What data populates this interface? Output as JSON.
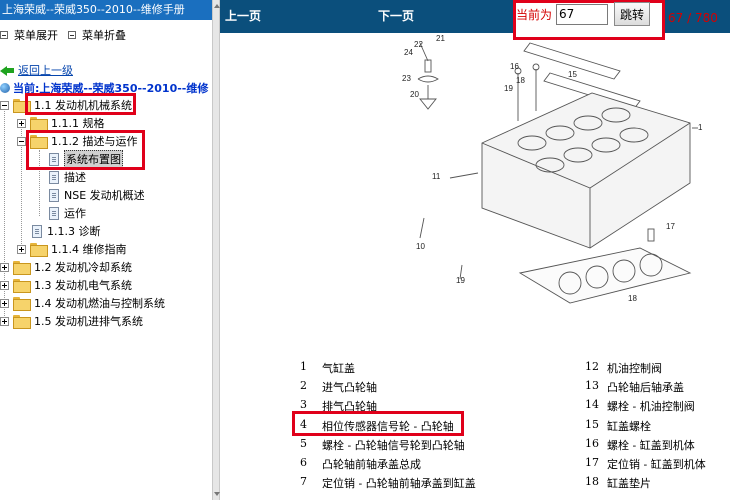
{
  "sidebar": {
    "title": "上海荣威--荣威350--2010--维修手册",
    "expand_label": "菜单展开",
    "collapse_label": "菜单折叠",
    "back_label": "返回上一级",
    "current_label": "当前:上海荣威--荣威350--2010--维修",
    "tree": [
      {
        "label": "1.1 发动机机械系统"
      },
      {
        "label": "1.1.1 规格"
      },
      {
        "label": "1.1.2 描述与运作"
      },
      {
        "label": "系统布置图"
      },
      {
        "label": "描述"
      },
      {
        "label": "NSE 发动机概述"
      },
      {
        "label": "运作"
      },
      {
        "label": "1.1.3 诊断"
      },
      {
        "label": "1.1.4 维修指南"
      },
      {
        "label": "1.2 发动机冷却系统"
      },
      {
        "label": "1.3 发动机电气系统"
      },
      {
        "label": "1.4 发动机燃油与控制系统"
      },
      {
        "label": "1.5 发动机进排气系统"
      }
    ]
  },
  "toolbar": {
    "prev_label": "上一页",
    "next_label": "下一页",
    "current_page_label": "当前为",
    "page_value": "67",
    "jump_label": "跳转",
    "page_count": "67 / 780"
  },
  "diagram": {
    "callouts": [
      "21",
      "24",
      "22",
      "23",
      "20",
      "16",
      "18",
      "15",
      "19",
      "1",
      "11",
      "10",
      "19",
      "17",
      "18"
    ]
  },
  "legend": [
    {
      "num": "1",
      "text": "气缸盖"
    },
    {
      "num": "12",
      "text": "机油控制阀"
    },
    {
      "num": "2",
      "text": "进气凸轮轴"
    },
    {
      "num": "13",
      "text": "凸轮轴后轴承盖"
    },
    {
      "num": "3",
      "text": "排气凸轮轴"
    },
    {
      "num": "14",
      "text": "螺栓 - 机油控制阀"
    },
    {
      "num": "4",
      "text": "相位传感器信号轮 - 凸轮轴"
    },
    {
      "num": "15",
      "text": "缸盖螺栓"
    },
    {
      "num": "5",
      "text": "螺栓 - 凸轮轴信号轮到凸轮轴"
    },
    {
      "num": "16",
      "text": "螺栓 - 缸盖到机体"
    },
    {
      "num": "6",
      "text": "凸轮轴前轴承盖总成"
    },
    {
      "num": "17",
      "text": "定位销 - 缸盖到机体"
    },
    {
      "num": "7",
      "text": "定位销 - 凸轮轴前轴承盖到缸盖"
    },
    {
      "num": "18",
      "text": "缸盖垫片"
    }
  ],
  "colors": {
    "accent_red": "#e0001a",
    "topbar_blue": "#0b4f7c",
    "sidebar_title_blue": "#1a6fbf",
    "link_blue": "#0645ad"
  }
}
